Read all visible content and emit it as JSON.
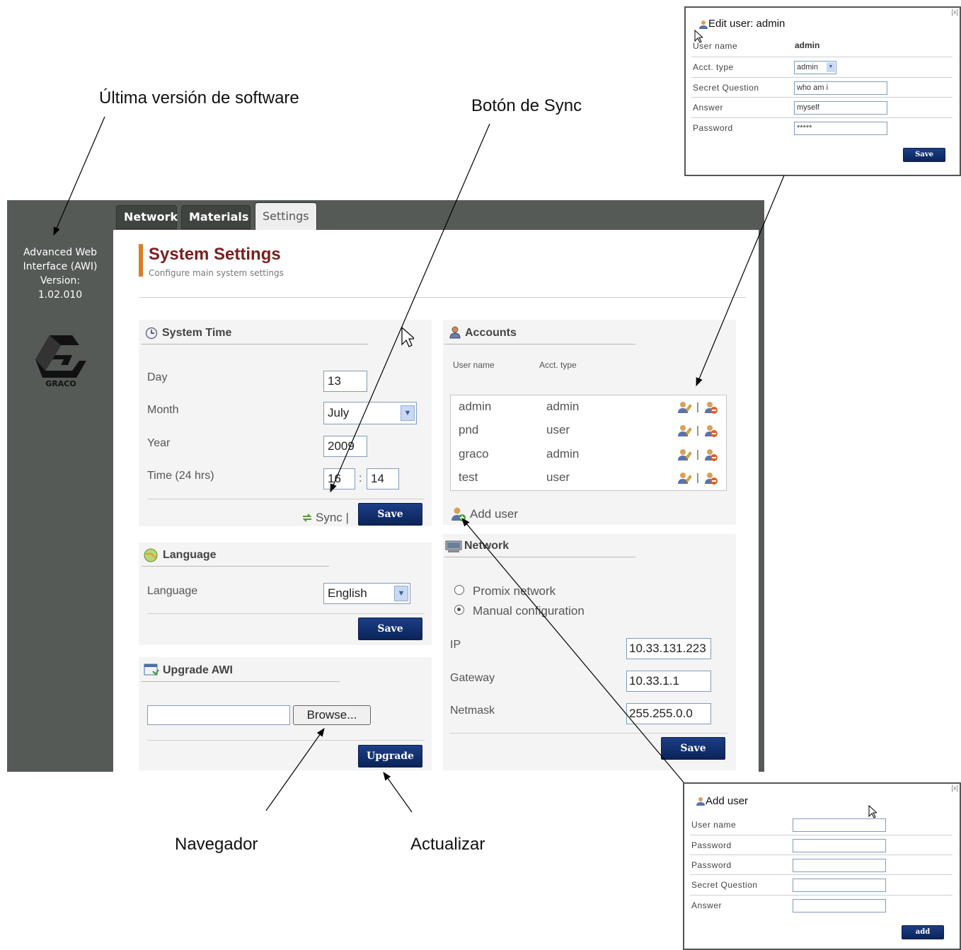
{
  "callouts": {
    "software_version": "Última versión de software",
    "sync_button": "Botón de Sync",
    "browser": "Navegador",
    "upgrade": "Actualizar"
  },
  "sidebar": {
    "version_line1": "Advanced Web",
    "version_line2": "Interface (AWI)",
    "version_line3": "Version:",
    "version_number": "1.02.010",
    "logo_text": "GRACO"
  },
  "tabs": [
    {
      "label": "Network",
      "active": false
    },
    {
      "label": "Materials",
      "active": false
    },
    {
      "label": "Settings",
      "active": true
    }
  ],
  "header": {
    "title": "System Settings",
    "subtitle": "Configure main system settings"
  },
  "system_time": {
    "title": "System Time",
    "day_label": "Day",
    "day_value": "13",
    "month_label": "Month",
    "month_value": "July",
    "year_label": "Year",
    "year_value": "2009",
    "time_label": "Time (24 hrs)",
    "hour_value": "16",
    "time_separator": ":",
    "minute_value": "14",
    "sync_label": "Sync |",
    "save_label": "Save"
  },
  "language": {
    "title": "Language",
    "label": "Language",
    "value": "English",
    "save_label": "Save"
  },
  "upgrade": {
    "title": "Upgrade AWI",
    "file_value": "",
    "browse_label": "Browse...",
    "upgrade_label": "Upgrade"
  },
  "accounts": {
    "title": "Accounts",
    "col_user": "User name",
    "col_type": "Acct. type",
    "separator": "|",
    "rows": [
      {
        "user": "admin",
        "type": "admin"
      },
      {
        "user": "pnd",
        "type": "user"
      },
      {
        "user": "graco",
        "type": "admin"
      },
      {
        "user": "test",
        "type": "user"
      }
    ],
    "add_user_label": "Add user"
  },
  "network": {
    "title": "Network",
    "option_promix": "Promix network",
    "option_manual": "Manual configuration",
    "selected_option": "manual",
    "ip_label": "IP",
    "ip_value": "10.33.131.223",
    "gateway_label": "Gateway",
    "gateway_value": "10.33.1.1",
    "netmask_label": "Netmask",
    "netmask_value": "255.255.0.0",
    "save_label": "Save"
  },
  "edit_user_popup": {
    "title": "Edit user: admin",
    "close": "[x]",
    "username_label": "User name",
    "username_value": "admin",
    "acct_type_label": "Acct. type",
    "acct_type_value": "admin",
    "secret_label": "Secret Question",
    "secret_value": "who am i",
    "answer_label": "Answer",
    "answer_value": "myself",
    "password_label": "Password",
    "password_value": "*****",
    "save_label": "Save"
  },
  "add_user_popup": {
    "title": "Add user",
    "close": "[x]",
    "username_label": "User name",
    "password_label": "Password",
    "password2_label": "Password",
    "secret_label": "Secret Question",
    "answer_label": "Answer",
    "add_label": "add"
  },
  "colors": {
    "frame": "#555a57",
    "header_accent": "#e07d1a",
    "title": "#7b1e1e",
    "button": "#0b2459"
  }
}
